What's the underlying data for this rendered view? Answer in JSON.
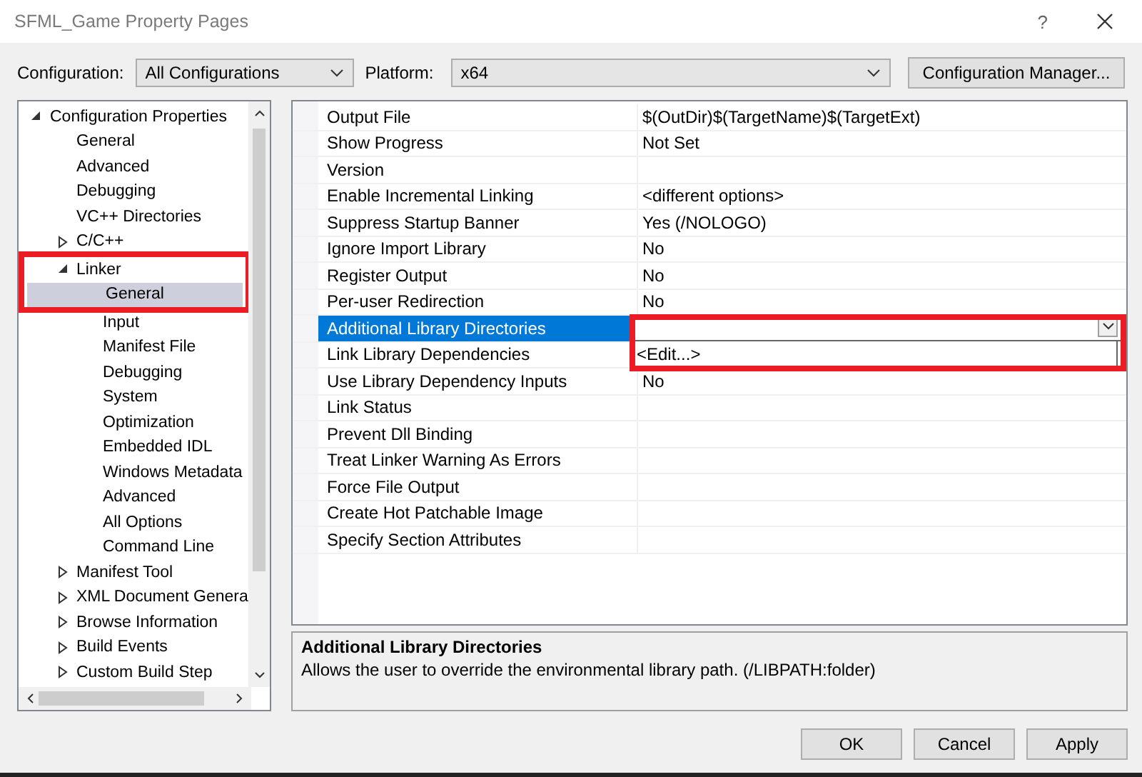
{
  "window": {
    "title": "SFML_Game Property Pages",
    "help_button": "?"
  },
  "toolbar": {
    "configuration_label": "Configuration:",
    "configuration_value": "All Configurations",
    "platform_label": "Platform:",
    "platform_value": "x64",
    "manager_button": "Configuration Manager..."
  },
  "tree": [
    {
      "label": "Configuration Properties",
      "expanded": true,
      "selected": false,
      "children": [
        {
          "label": "General",
          "selected": false
        },
        {
          "label": "Advanced",
          "selected": false
        },
        {
          "label": "Debugging",
          "selected": false
        },
        {
          "label": "VC++ Directories",
          "selected": false
        },
        {
          "label": "C/C++",
          "expanded": false,
          "selected": false
        },
        {
          "label": "Linker",
          "expanded": true,
          "selected": false,
          "marked": true,
          "children": [
            {
              "label": "General",
              "selected": true
            },
            {
              "label": "Input",
              "selected": false
            },
            {
              "label": "Manifest File",
              "selected": false
            },
            {
              "label": "Debugging",
              "selected": false
            },
            {
              "label": "System",
              "selected": false
            },
            {
              "label": "Optimization",
              "selected": false
            },
            {
              "label": "Embedded IDL",
              "selected": false
            },
            {
              "label": "Windows Metadata",
              "selected": false
            },
            {
              "label": "Advanced",
              "selected": false
            },
            {
              "label": "All Options",
              "selected": false
            },
            {
              "label": "Command Line",
              "selected": false
            }
          ]
        },
        {
          "label": "Manifest Tool",
          "expanded": false,
          "selected": false
        },
        {
          "label": "XML Document Genera",
          "expanded": false,
          "selected": false
        },
        {
          "label": "Browse Information",
          "expanded": false,
          "selected": false
        },
        {
          "label": "Build Events",
          "expanded": false,
          "selected": false
        },
        {
          "label": "Custom Build Step",
          "expanded": false,
          "selected": false
        }
      ]
    }
  ],
  "grid": {
    "rows": [
      {
        "name": "Output File",
        "value": "$(OutDir)$(TargetName)$(TargetExt)",
        "selected": false
      },
      {
        "name": "Show Progress",
        "value": "Not Set",
        "selected": false
      },
      {
        "name": "Version",
        "selected": false
      },
      {
        "name": "Enable Incremental Linking",
        "value": "<different options>",
        "selected": false
      },
      {
        "name": "Suppress Startup Banner",
        "value": "Yes (/NOLOGO)",
        "selected": false
      },
      {
        "name": "Ignore Import Library",
        "value": "No",
        "selected": false
      },
      {
        "name": "Register Output",
        "value": "No",
        "selected": false
      },
      {
        "name": "Per-user Redirection",
        "value": "No",
        "selected": false
      },
      {
        "name": "Additional Library Directories",
        "selected": true,
        "editor": {
          "options": [
            "<Edit...>"
          ],
          "marked": true
        }
      },
      {
        "name": "Link Library Dependencies",
        "selected": false
      },
      {
        "name": "Use Library Dependency Inputs",
        "value": "No",
        "selected": false
      },
      {
        "name": "Link Status",
        "selected": false
      },
      {
        "name": "Prevent Dll Binding",
        "selected": false
      },
      {
        "name": "Treat Linker Warning As Errors",
        "selected": false
      },
      {
        "name": "Force File Output",
        "selected": false
      },
      {
        "name": "Create Hot Patchable Image",
        "selected": false
      },
      {
        "name": "Specify Section Attributes",
        "selected": false
      }
    ]
  },
  "description": {
    "title": "Additional Library Directories",
    "text": "Allows the user to override the environmental library path. (/LIBPATH:folder)"
  },
  "buttons": [
    "OK",
    "Cancel",
    "Apply"
  ]
}
